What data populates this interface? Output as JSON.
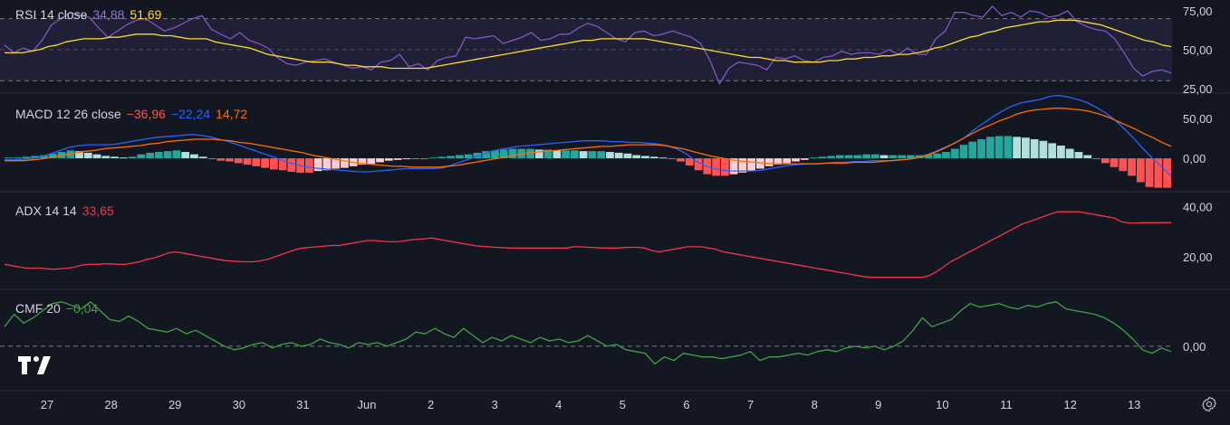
{
  "colors": {
    "background": "#131722",
    "rsi_band": "#7e57c2",
    "rsi_line": "#7e57c2",
    "rsi_ma": "#fdd835",
    "macd_line": "#2962ff",
    "macd_signal": "#ff6d00",
    "hist_up_strong": "#26a69a",
    "hist_up_weak": "#b2dfdb",
    "hist_down_weak": "#ffcdd2",
    "hist_down_strong": "#ff5252",
    "adx_line": "#f23645",
    "cmf_line": "#43a047",
    "axis_text": "#d1d4dc",
    "grid": "#2a2e39"
  },
  "icons": {
    "logo": "tradingview-logo-icon",
    "settings": "gear-icon"
  },
  "legends": {
    "rsi": {
      "name": "RSI 14 close",
      "v1": "34,88",
      "v2": "51,69"
    },
    "macd": {
      "name": "MACD 12 26 close",
      "v1": "−36,96",
      "v2": "−22,24",
      "v3": "14,72"
    },
    "adx": {
      "name": "ADX 14 14",
      "v1": "33,65"
    },
    "cmf": {
      "name": "CMF 20",
      "v1": "−0,04"
    }
  },
  "chart_data": [
    {
      "type": "line",
      "title": "RSI 14 close",
      "ylim": [
        22,
        82
      ],
      "y_ticks": [
        "75,00",
        "50,00",
        "25,00"
      ],
      "y_tick_values": [
        75,
        50,
        25
      ],
      "bands": [
        70,
        30
      ],
      "series": [
        {
          "name": "RSI",
          "values": [
            53,
            48,
            51,
            49,
            56,
            66,
            70,
            74,
            72,
            71,
            64,
            58,
            62,
            66,
            69,
            70,
            66,
            62,
            64,
            67,
            70,
            72,
            63,
            60,
            57,
            61,
            56,
            54,
            51,
            45,
            41,
            40,
            42,
            43,
            44,
            42,
            40,
            38,
            39,
            37,
            42,
            43,
            47,
            39,
            41,
            37,
            43,
            45,
            46,
            58,
            57,
            58,
            59,
            54,
            56,
            58,
            61,
            56,
            57,
            60,
            60,
            64,
            67,
            65,
            61,
            57,
            55,
            61,
            62,
            59,
            60,
            62,
            60,
            58,
            54,
            43,
            28,
            38,
            42,
            41,
            40,
            37,
            45,
            44,
            46,
            43,
            42,
            45,
            46,
            49,
            47,
            48,
            48,
            47,
            50,
            47,
            51,
            47,
            47,
            57,
            62,
            74,
            74,
            72,
            71,
            78,
            72,
            74,
            71,
            75,
            74,
            71,
            72,
            75,
            68,
            65,
            63,
            62,
            57,
            48,
            38,
            33,
            36,
            37,
            35
          ]
        },
        {
          "name": "MA",
          "values": [
            48,
            48,
            48,
            49,
            50,
            52,
            53,
            55,
            56,
            57,
            57,
            57,
            58,
            58,
            59,
            60,
            60,
            60,
            59,
            59,
            58,
            57,
            57,
            57,
            55,
            54,
            53,
            52,
            51,
            49,
            47,
            46,
            45,
            44,
            43,
            42,
            42,
            42,
            41,
            40,
            40,
            39,
            39,
            39,
            38,
            38,
            38,
            38,
            38,
            39,
            40,
            41,
            42,
            43,
            44,
            45,
            46,
            47,
            48,
            49,
            50,
            51,
            52,
            53,
            54,
            55,
            56,
            56,
            57,
            57,
            57,
            57,
            57,
            57,
            56,
            55,
            54,
            53,
            52,
            51,
            50,
            49,
            48,
            47,
            46,
            45,
            45,
            44,
            43,
            43,
            42,
            42,
            42,
            42,
            43,
            43,
            44,
            44,
            45,
            45,
            46,
            46,
            47,
            47,
            48,
            49,
            51,
            52,
            54,
            56,
            58,
            59,
            61,
            62,
            64,
            65,
            66,
            67,
            68,
            68,
            69,
            69,
            69,
            68,
            67,
            66,
            64,
            62,
            60,
            58,
            56,
            55,
            53,
            52
          ]
        }
      ]
    },
    {
      "type": "bar",
      "title": "MACD 12 26 close",
      "ylim": [
        -42,
        82
      ],
      "y_ticks": [
        "50,00",
        "0,00"
      ],
      "y_tick_values": [
        50,
        0
      ],
      "series": [
        {
          "name": "Histogram",
          "values": [
            1,
            1,
            2,
            3,
            4,
            6,
            8,
            10,
            9,
            7,
            5,
            3,
            2,
            1,
            2,
            5,
            7,
            8,
            9,
            10,
            8,
            5,
            2,
            -1,
            -3,
            -4,
            -6,
            -8,
            -10,
            -12,
            -14,
            -15,
            -17,
            -18,
            -18,
            -16,
            -15,
            -13,
            -12,
            -10,
            -8,
            -7,
            -5,
            -3,
            -2,
            -1,
            -1,
            -1,
            1,
            2,
            3,
            4,
            5,
            7,
            9,
            10,
            11,
            12,
            12,
            12,
            11,
            11,
            10,
            10,
            10,
            9,
            9,
            9,
            8,
            7,
            6,
            4,
            3,
            2,
            1,
            -1,
            -4,
            -9,
            -15,
            -20,
            -22,
            -22,
            -20,
            -18,
            -16,
            -13,
            -10,
            -8,
            -6,
            -4,
            -2,
            1,
            2,
            3,
            4,
            4,
            4,
            5,
            5,
            4,
            4,
            4,
            4,
            4,
            5,
            6,
            8,
            12,
            17,
            21,
            24,
            27,
            28,
            28,
            27,
            26,
            24,
            22,
            19,
            16,
            12,
            8,
            4,
            -1,
            -6,
            -11,
            -16,
            -22,
            -30,
            -36,
            -37,
            -37
          ]
        },
        {
          "name": "MACD",
          "values": [
            -2,
            -2,
            -1,
            0,
            2,
            6,
            10,
            14,
            16,
            17,
            17,
            17,
            18,
            20,
            22,
            24,
            26,
            27,
            28,
            29,
            30,
            29,
            27,
            24,
            21,
            17,
            13,
            9,
            5,
            1,
            -4,
            -7,
            -10,
            -12,
            -13,
            -14,
            -15,
            -16,
            -17,
            -17,
            -16,
            -15,
            -14,
            -13,
            -13,
            -13,
            -13,
            -12,
            -8,
            -4,
            0,
            4,
            8,
            11,
            13,
            15,
            16,
            17,
            18,
            19,
            20,
            21,
            22,
            22,
            22,
            21,
            21,
            20,
            20,
            19,
            18,
            16,
            12,
            6,
            -3,
            -9,
            -13,
            -15,
            -16,
            -16,
            -16,
            -15,
            -13,
            -11,
            -9,
            -8,
            -7,
            -7,
            -6,
            -5,
            -5,
            -4,
            -4,
            -3,
            -3,
            -3,
            -2,
            -1,
            1,
            5,
            10,
            15,
            20,
            27,
            37,
            45,
            53,
            60,
            66,
            70,
            72,
            74,
            78,
            79,
            77,
            74,
            70,
            64,
            57,
            48,
            37,
            25,
            12,
            0,
            -11,
            -22
          ]
        },
        {
          "name": "Signal",
          "values": [
            -3,
            -3,
            -3,
            -2,
            -1,
            1,
            3,
            5,
            7,
            9,
            10,
            12,
            13,
            14,
            15,
            16,
            18,
            19,
            21,
            22,
            23,
            24,
            24,
            24,
            23,
            22,
            20,
            19,
            17,
            15,
            13,
            11,
            9,
            7,
            4,
            2,
            0,
            -2,
            -4,
            -6,
            -7,
            -8,
            -9,
            -10,
            -10,
            -11,
            -11,
            -11,
            -11,
            -10,
            -9,
            -7,
            -5,
            -3,
            -1,
            1,
            3,
            5,
            7,
            8,
            9,
            10,
            11,
            12,
            13,
            14,
            15,
            15,
            16,
            17,
            17,
            17,
            17,
            16,
            14,
            12,
            9,
            6,
            3,
            1,
            -1,
            -3,
            -4,
            -5,
            -6,
            -7,
            -7,
            -7,
            -7,
            -7,
            -7,
            -6,
            -6,
            -6,
            -5,
            -5,
            -5,
            -4,
            -3,
            -2,
            -1,
            1,
            4,
            8,
            13,
            19,
            25,
            31,
            37,
            42,
            47,
            51,
            56,
            59,
            61,
            62,
            63,
            63,
            62,
            61,
            59,
            56,
            52,
            47,
            42,
            37,
            31,
            26,
            20,
            15
          ]
        }
      ]
    },
    {
      "type": "line",
      "title": "ADX 14 14",
      "ylim": [
        7,
        46
      ],
      "y_ticks": [
        "40,00",
        "20,00"
      ],
      "y_tick_values": [
        40,
        20
      ],
      "series": [
        {
          "name": "ADX",
          "values": [
            17,
            16.5,
            16,
            15.5,
            15.5,
            15.5,
            15.2,
            15,
            15.3,
            15.5,
            16,
            16.8,
            17,
            17,
            17.2,
            17.2,
            17,
            17,
            17.5,
            18,
            19,
            19.5,
            20.5,
            21.5,
            22,
            21.5,
            21,
            20.5,
            20,
            19.5,
            19,
            18.5,
            18.3,
            18.1,
            18,
            18,
            18.4,
            19,
            20,
            21,
            22,
            23,
            23.5,
            23.8,
            24,
            24.3,
            24.5,
            24.5,
            25,
            25.5,
            26,
            26.5,
            26.5,
            26.3,
            26,
            26,
            26.3,
            26.7,
            27,
            27.2,
            27.5,
            27,
            26.5,
            26,
            25.5,
            25,
            24.5,
            24.2,
            24,
            23.8,
            23.7,
            23.5,
            23.5,
            23.5,
            23.5,
            23.5,
            23.5,
            23.5,
            23.5,
            23.5,
            24,
            24,
            23.8,
            23.7,
            23.5,
            23.5,
            23.5,
            23.7,
            23.8,
            23.8,
            23.5,
            22.5,
            22,
            22.5,
            23,
            23.5,
            24,
            24,
            24,
            23.5,
            23,
            22,
            21.5,
            21,
            20.5,
            20,
            19.5,
            19,
            18.5,
            18,
            17.5,
            17,
            16.5,
            16,
            15.5,
            15,
            14.5,
            14,
            13.5,
            13,
            12.5,
            12,
            11.8,
            11.8,
            11.8,
            11.8,
            11.8,
            11.8,
            11.8,
            11.8,
            12.5,
            14,
            16,
            18,
            19.5,
            21,
            22.5,
            24,
            25.5,
            27,
            28.5,
            30,
            31.5,
            33,
            34,
            35,
            36,
            37,
            38,
            38,
            38,
            38,
            37.5,
            37,
            36.5,
            36,
            35.5,
            34,
            33.5,
            33.5,
            33.6,
            33.6,
            33.6,
            33.6,
            33.65
          ]
        }
      ]
    },
    {
      "type": "line",
      "title": "CMF 20",
      "ylim": [
        -0.25,
        0.32
      ],
      "y_ticks": [
        "0,00"
      ],
      "y_tick_values": [
        0
      ],
      "series": [
        {
          "name": "CMF",
          "values": [
            0.11,
            0.18,
            0.13,
            0.16,
            0.2,
            0.24,
            0.25,
            0.23,
            0.21,
            0.25,
            0.2,
            0.15,
            0.14,
            0.17,
            0.14,
            0.1,
            0.09,
            0.08,
            0.1,
            0.07,
            0.09,
            0.06,
            0.03,
            0.0,
            -0.02,
            -0.01,
            0.01,
            0.02,
            -0.01,
            0.01,
            0.02,
            0.0,
            0.01,
            0.04,
            0.02,
            0.01,
            -0.01,
            0.02,
            0.01,
            0.02,
            0.0,
            0.02,
            0.04,
            0.08,
            0.07,
            0.1,
            0.07,
            0.05,
            0.1,
            0.06,
            0.02,
            0.05,
            0.03,
            0.06,
            0.04,
            0.02,
            0.05,
            0.03,
            0.04,
            0.02,
            0.03,
            0.06,
            0.03,
            0.0,
            0.01,
            -0.02,
            -0.03,
            -0.04,
            -0.1,
            -0.06,
            -0.08,
            -0.04,
            -0.05,
            -0.06,
            -0.06,
            -0.07,
            -0.06,
            -0.05,
            -0.03,
            -0.08,
            -0.06,
            -0.06,
            -0.05,
            -0.04,
            -0.05,
            -0.03,
            -0.02,
            -0.03,
            -0.01,
            0.0,
            -0.01,
            0.0,
            -0.02,
            0.0,
            0.03,
            0.09,
            0.16,
            0.11,
            0.13,
            0.15,
            0.2,
            0.24,
            0.22,
            0.23,
            0.24,
            0.22,
            0.21,
            0.23,
            0.22,
            0.24,
            0.25,
            0.21,
            0.2,
            0.19,
            0.18,
            0.16,
            0.13,
            0.09,
            0.04,
            -0.02,
            -0.04,
            -0.01,
            -0.03
          ]
        }
      ]
    }
  ],
  "x_axis": {
    "labels": [
      "27",
      "28",
      "29",
      "30",
      "31",
      "Jun",
      "2",
      "3",
      "4",
      "5",
      "6",
      "7",
      "8",
      "9",
      "10",
      "11",
      "12",
      "13"
    ]
  }
}
